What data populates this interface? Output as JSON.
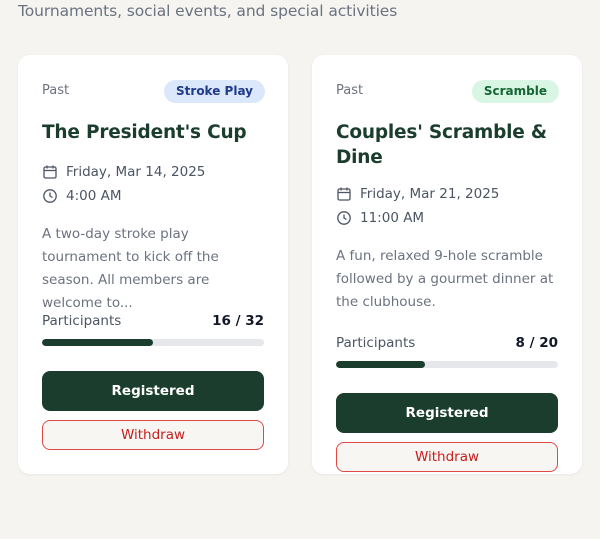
{
  "header": {
    "subtitle": "Tournaments, social events, and special activities"
  },
  "colors": {
    "primary": "#1a3d2d",
    "danger": "#c81e1e",
    "stroke_badge_bg": "#dbe7fb",
    "scramble_badge_bg": "#d9f5e3"
  },
  "events": [
    {
      "status": "Past",
      "badge": "Stroke Play",
      "title": "The President's Cup",
      "date": "Friday, Mar 14, 2025",
      "time": "4:00 AM",
      "description": "A two-day stroke play tournament to kick off the season. All members are welcome to...",
      "participants_label": "Participants",
      "participants_text": "16 / 32",
      "participants": 16,
      "capacity": 32,
      "registered_label": "Registered",
      "withdraw_label": "Withdraw",
      "date_icon": "calendar-icon",
      "time_icon": "clock-icon"
    },
    {
      "status": "Past",
      "badge": "Scramble",
      "title": "Couples' Scramble & Dine",
      "date": "Friday, Mar 21, 2025",
      "time": "11:00 AM",
      "description": "A fun, relaxed 9-hole scramble followed by a gourmet dinner at the clubhouse.",
      "participants_label": "Participants",
      "participants_text": "8 / 20",
      "participants": 8,
      "capacity": 20,
      "registered_label": "Registered",
      "withdraw_label": "Withdraw",
      "date_icon": "calendar-icon",
      "time_icon": "clock-icon"
    }
  ]
}
